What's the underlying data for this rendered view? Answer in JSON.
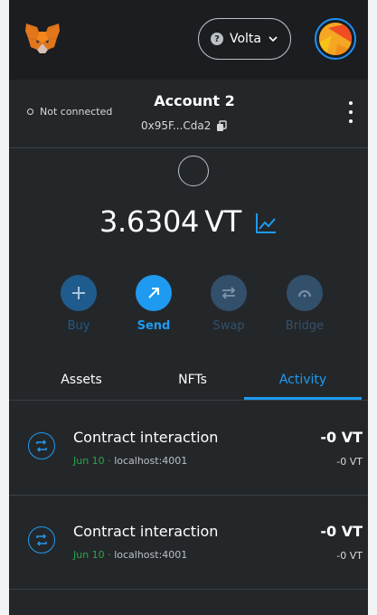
{
  "header": {
    "network_label": "Volta",
    "network_icon_letter": "?"
  },
  "account": {
    "connection_status": "Not connected",
    "name": "Account 2",
    "address": "0x95F...Cda2"
  },
  "balance": {
    "amount": "3.6304",
    "symbol": "VT"
  },
  "actions": [
    {
      "label": "Buy",
      "icon": "plus-icon"
    },
    {
      "label": "Send",
      "icon": "arrow-up-right-icon"
    },
    {
      "label": "Swap",
      "icon": "swap-arrows-icon"
    },
    {
      "label": "Bridge",
      "icon": "bridge-arch-icon"
    }
  ],
  "tabs": [
    {
      "label": "Assets",
      "active": false
    },
    {
      "label": "NFTs",
      "active": false
    },
    {
      "label": "Activity",
      "active": true
    }
  ],
  "activity": [
    {
      "title": "Contract interaction",
      "date": "Jun 10",
      "separator": "·",
      "origin": "localhost:4001",
      "amount": "-0 VT",
      "fiat": "-0 VT"
    },
    {
      "title": "Contract interaction",
      "date": "Jun 10",
      "separator": "·",
      "origin": "localhost:4001",
      "amount": "-0 VT",
      "fiat": "-0 VT"
    }
  ],
  "colors": {
    "accent": "#1e9bf0",
    "background": "#24272a",
    "header": "#1b1d20",
    "success": "#28a745"
  }
}
